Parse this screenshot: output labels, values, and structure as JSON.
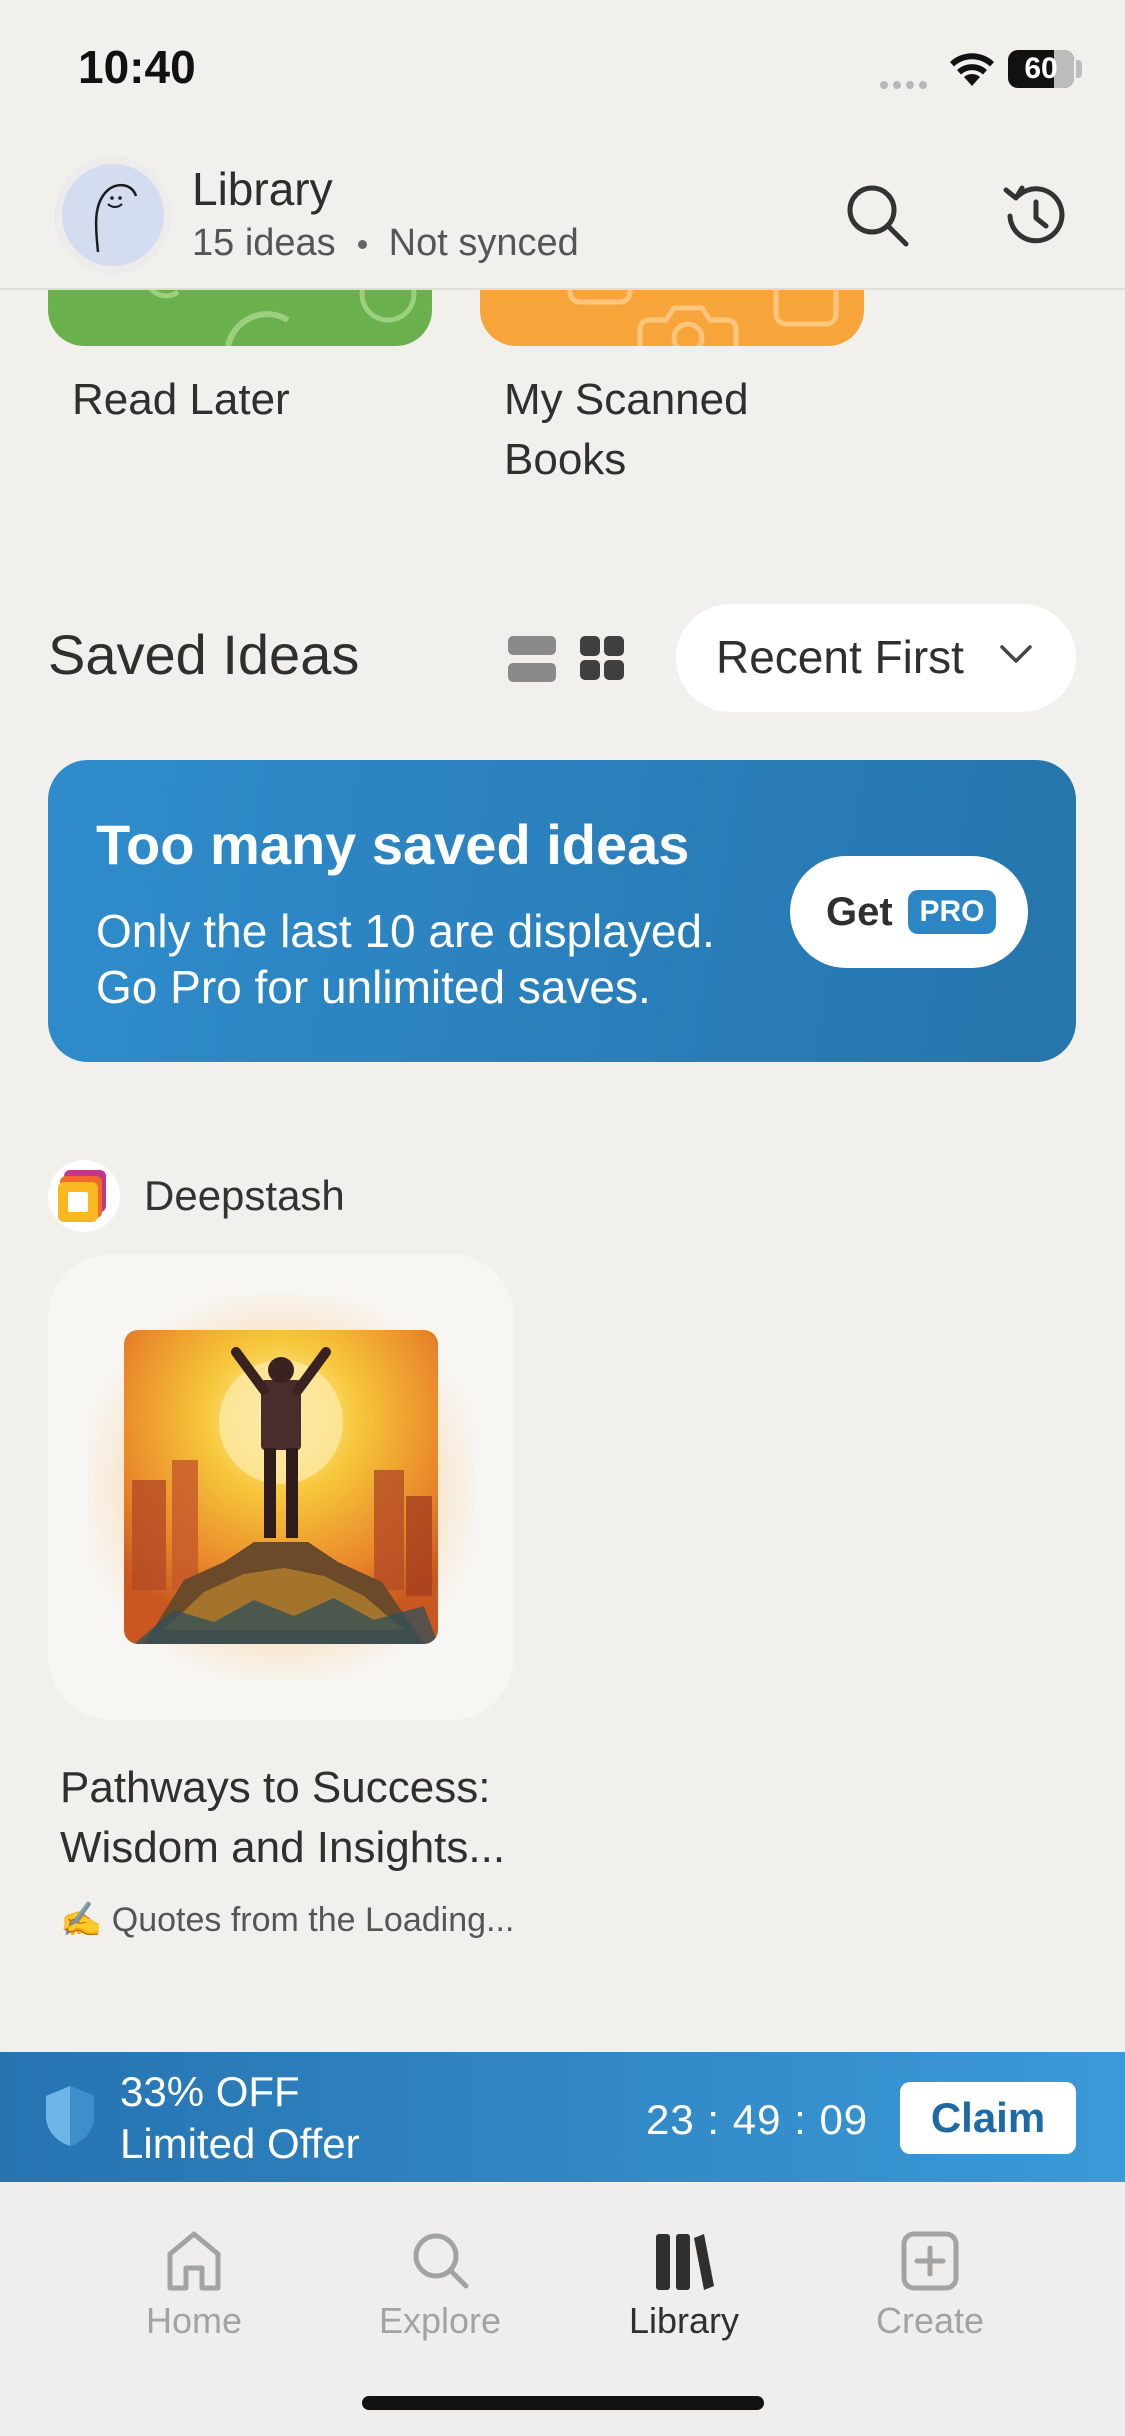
{
  "status_bar": {
    "time": "10:40",
    "battery": "60"
  },
  "header": {
    "title": "Library",
    "ideas_count": "15 ideas",
    "sync_status": "Not synced",
    "icons": {
      "search": "search-icon",
      "history": "history-icon"
    }
  },
  "collections": [
    {
      "label": "Read Later",
      "color": "#6ab04c"
    },
    {
      "label_line1": "My Scanned",
      "label_line2": "Books",
      "color": "#f7a53b"
    }
  ],
  "saved_ideas": {
    "title": "Saved Ideas",
    "sort_label": "Recent First"
  },
  "pro_banner": {
    "title": "Too many saved ideas",
    "line1": "Only the last 10 are displayed.",
    "line2": "Go Pro for unlimited saves.",
    "button_get": "Get",
    "button_pro": "PRO",
    "color": "#2c86c4"
  },
  "source": {
    "name": "Deepstash"
  },
  "idea": {
    "title_line1": "Pathways to Success:",
    "title_line2": "Wisdom and Insights...",
    "source_emoji": "✍️",
    "source_text": "Quotes from the Loading..."
  },
  "offer": {
    "discount": "33% OFF",
    "label": "Limited Offer",
    "timer": "23 : 49 : 09",
    "claim_label": "Claim"
  },
  "tabs": [
    {
      "label": "Home",
      "icon": "home-icon"
    },
    {
      "label": "Explore",
      "icon": "search-icon"
    },
    {
      "label": "Library",
      "icon": "library-icon",
      "active": true
    },
    {
      "label": "Create",
      "icon": "plus-square-icon"
    }
  ]
}
